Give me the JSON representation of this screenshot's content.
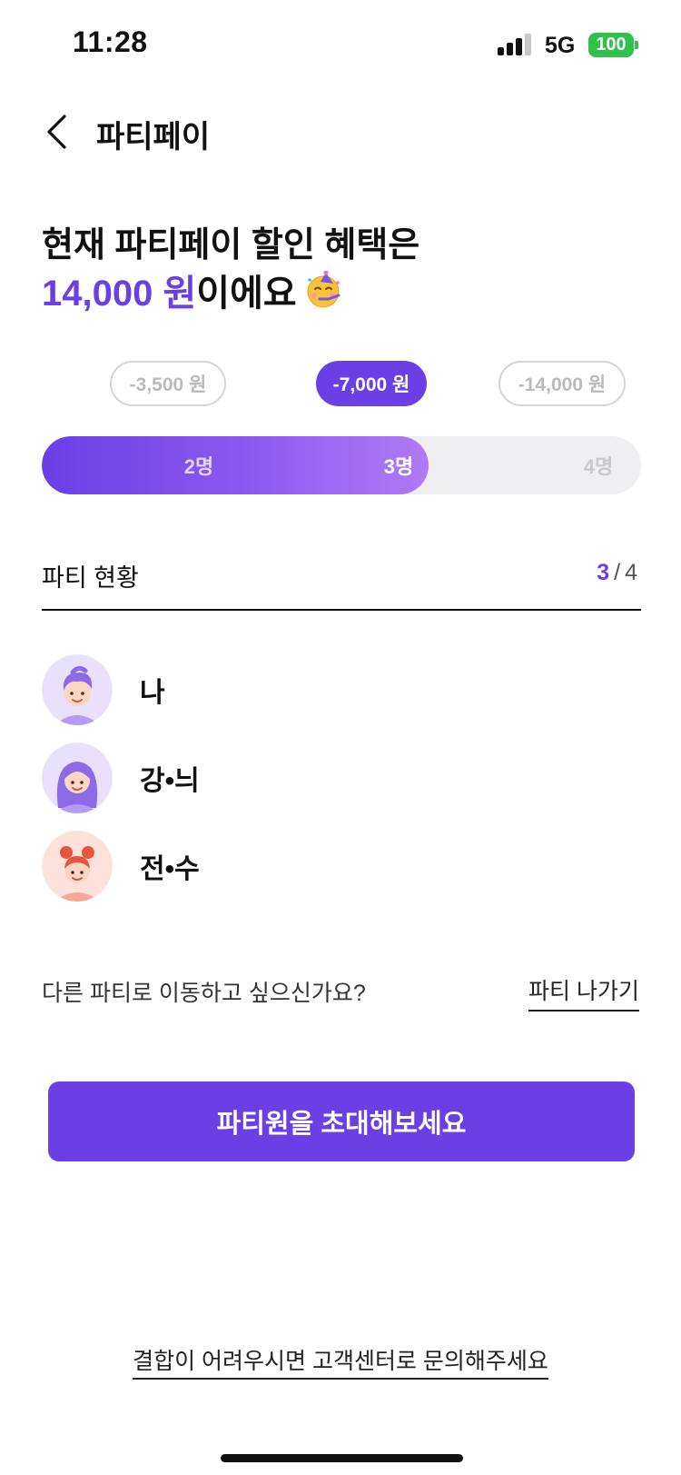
{
  "status_bar": {
    "time": "11:28",
    "network": "5G",
    "battery": "100",
    "signal_bars_active": 3,
    "signal_bars_total": 4
  },
  "header": {
    "title": "파티페이",
    "back_icon": "chevron-left-icon"
  },
  "headline": {
    "line1": "현재 파티페이 할인 혜택은",
    "amount": "14,000 원",
    "suffix": "이에요",
    "emoji_icon": "partying-face-icon"
  },
  "discount_tiers": [
    {
      "label": "-3,500 원",
      "active": false
    },
    {
      "label": "-7,000 원",
      "active": true
    },
    {
      "label": "-14,000 원",
      "active": false
    }
  ],
  "progress": {
    "steps": [
      "2명",
      "3명",
      "4명"
    ],
    "current_step_index": 1,
    "fill_fraction": 0.645
  },
  "party_status": {
    "title": "파티 현황",
    "current": "3",
    "separator": "/",
    "total": "4"
  },
  "members": [
    {
      "name": "나",
      "avatar_icon": "avatar-boy-purple-hair-icon"
    },
    {
      "name": "강•늬",
      "avatar_icon": "avatar-girl-purple-hair-icon"
    },
    {
      "name": "전•수",
      "avatar_icon": "avatar-girl-red-hair-icon"
    }
  ],
  "move_party": {
    "question": "다른 파티로 이동하고 싶으신가요?",
    "leave_label": "파티 나가기"
  },
  "invite_button": "파티원을 초대해보세요",
  "support_link": "결합이 어려우시면 고객센터로 문의해주세요",
  "colors": {
    "accent": "#6a3fe6",
    "battery": "#2fc14b"
  }
}
